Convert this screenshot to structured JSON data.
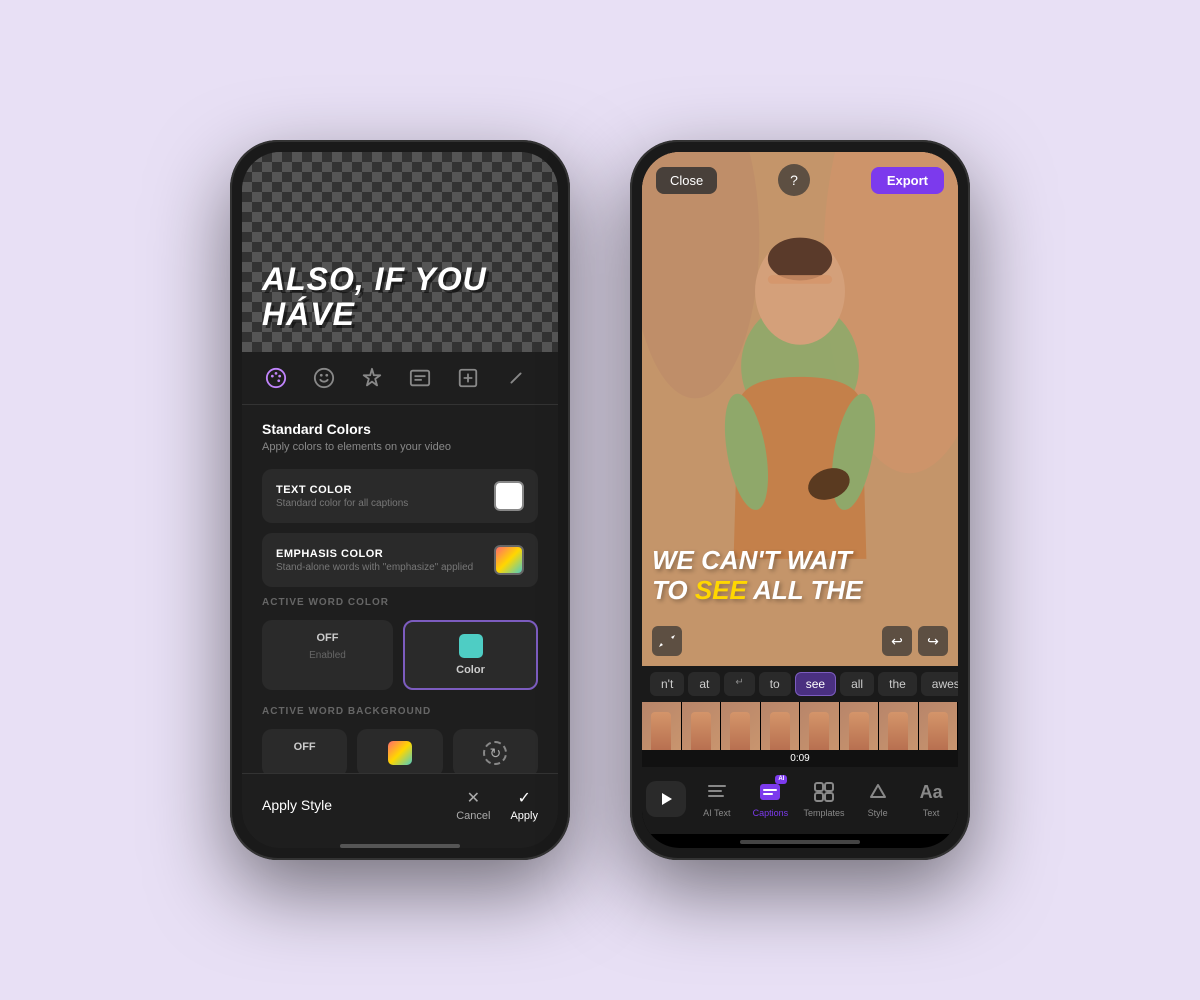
{
  "background": "#e8e0f5",
  "left_phone": {
    "video_text": "ALSO,\nIF YOU HÁVE",
    "toolbar": {
      "icons": [
        "palette",
        "emoji",
        "sparkles",
        "caption",
        "text",
        "slash"
      ]
    },
    "standard_colors": {
      "title": "Standard Colors",
      "subtitle": "Apply colors to elements on your video"
    },
    "text_color": {
      "label": "TEXT COLOR",
      "desc": "Standard color for all captions"
    },
    "emphasis_color": {
      "label": "EMPHASIS COLOR",
      "desc": "Stand-alone words with \"emphasize\" applied"
    },
    "active_word_color": {
      "label": "ACTIVE WORD COLOR",
      "off_label": "OFF",
      "off_sublabel": "Enabled",
      "color_label": "Color",
      "color_sublabel": "Color"
    },
    "active_word_background": {
      "label": "ACTIVE WORD BACKGROUND",
      "off_label": "OFF"
    },
    "apply_style_label": "Apply Style",
    "cancel_label": "Cancel",
    "apply_label": "Apply"
  },
  "right_phone": {
    "close_label": "Close",
    "export_label": "Export",
    "caption_line1": "WE CAN'T WAIT",
    "caption_line2_before": "TO ",
    "caption_highlight": "SEE",
    "caption_line2_after": " ALL THE",
    "time_label": "0:09",
    "word_chips": [
      "n't",
      "at",
      "to",
      "see",
      "all",
      "the",
      "awesome"
    ],
    "active_chip": "see",
    "newline_chip": "↵",
    "nav": {
      "play_icon": "▶",
      "captions_label": "Captions",
      "templates_label": "Templates",
      "style_label": "Style",
      "text_label": "Text",
      "active_nav": "captions"
    }
  }
}
